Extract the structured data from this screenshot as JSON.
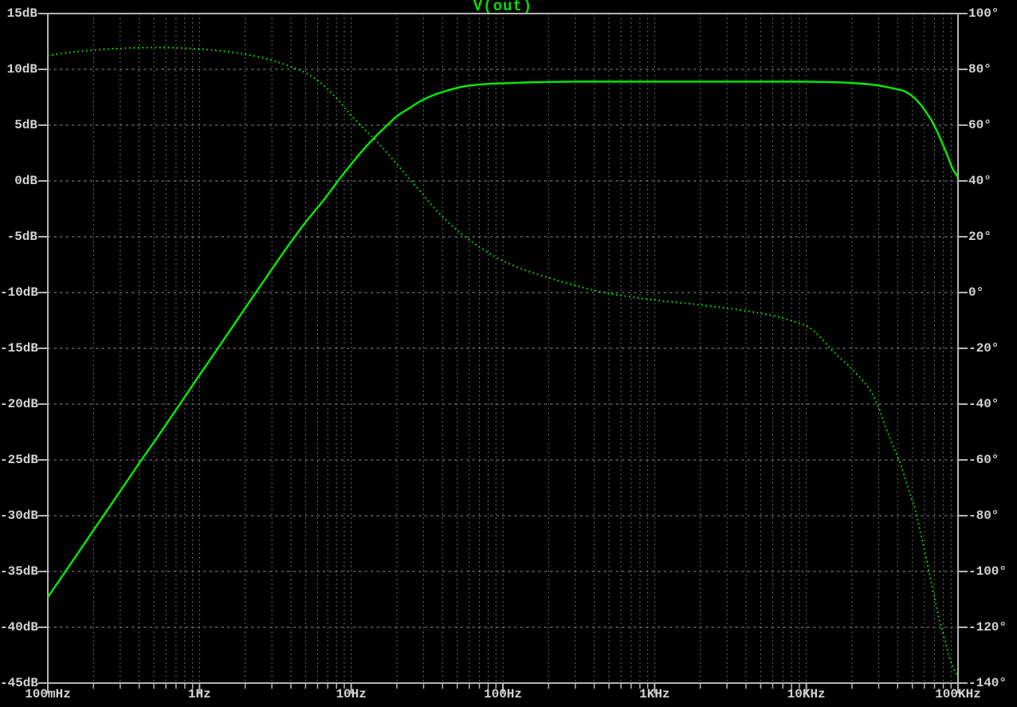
{
  "colors": {
    "background": "#000000",
    "trace": "#00ee00",
    "title": "#00dd00",
    "grid": "#8a8a8a",
    "frame": "#b4b4b4",
    "label": "#d4d4d4"
  },
  "chart_data": {
    "type": "line",
    "title": "V(out)",
    "grid": true,
    "legend_position": "top-center",
    "x_axis": {
      "scale": "log",
      "min": 0.1,
      "max": 100000,
      "unit": "Hz",
      "tick_labels": [
        "100mHz",
        "1Hz",
        "10Hz",
        "100Hz",
        "1KHz",
        "10KHz",
        "100KHz"
      ],
      "tick_values": [
        0.1,
        1,
        10,
        100,
        1000,
        10000,
        100000
      ]
    },
    "y_left": {
      "unit": "dB",
      "min": -45,
      "max": 15,
      "step": 5,
      "tick_labels": [
        "15dB",
        "10dB",
        "5dB",
        "0dB",
        "-5dB",
        "-10dB",
        "-15dB",
        "-20dB",
        "-25dB",
        "-30dB",
        "-35dB",
        "-40dB",
        "-45dB"
      ],
      "tick_values": [
        15,
        10,
        5,
        0,
        -5,
        -10,
        -15,
        -20,
        -25,
        -30,
        -35,
        -40,
        -45
      ]
    },
    "y_right": {
      "unit": "°",
      "min": -140,
      "max": 100,
      "step": 20,
      "tick_labels": [
        "100°",
        "80°",
        "60°",
        "40°",
        "20°",
        "0°",
        "-20°",
        "-40°",
        "-60°",
        "-80°",
        "-100°",
        "-120°",
        "-140°"
      ],
      "tick_values": [
        100,
        80,
        60,
        40,
        20,
        0,
        -20,
        -40,
        -60,
        -80,
        -100,
        -120,
        -140
      ]
    },
    "series": [
      {
        "name": "V(out) magnitude",
        "axis": "left",
        "style": "solid",
        "unit": "dB",
        "points": [
          [
            0.1,
            -37.3
          ],
          [
            0.14,
            -34.4
          ],
          [
            0.2,
            -31.3
          ],
          [
            0.28,
            -28.4
          ],
          [
            0.4,
            -25.3
          ],
          [
            0.55,
            -22.6
          ],
          [
            0.75,
            -19.9
          ],
          [
            1,
            -17.4
          ],
          [
            1.4,
            -14.5
          ],
          [
            2,
            -11.4
          ],
          [
            2.8,
            -8.5
          ],
          [
            3.8,
            -5.9
          ],
          [
            5,
            -3.7
          ],
          [
            6.5,
            -1.8
          ],
          [
            8.5,
            0.3
          ],
          [
            10,
            1.5
          ],
          [
            12,
            2.8
          ],
          [
            14.5,
            4.0
          ],
          [
            17,
            4.9
          ],
          [
            20,
            5.8
          ],
          [
            24,
            6.5
          ],
          [
            29,
            7.2
          ],
          [
            35,
            7.7
          ],
          [
            43,
            8.1
          ],
          [
            52,
            8.4
          ],
          [
            65,
            8.6
          ],
          [
            80,
            8.7
          ],
          [
            100,
            8.75
          ],
          [
            140,
            8.82
          ],
          [
            200,
            8.87
          ],
          [
            300,
            8.9
          ],
          [
            500,
            8.9
          ],
          [
            800,
            8.9
          ],
          [
            1300,
            8.9
          ],
          [
            2000,
            8.9
          ],
          [
            3200,
            8.9
          ],
          [
            5000,
            8.9
          ],
          [
            8000,
            8.9
          ],
          [
            12000,
            8.88
          ],
          [
            16000,
            8.84
          ],
          [
            20000,
            8.78
          ],
          [
            25000,
            8.68
          ],
          [
            30000,
            8.55
          ],
          [
            35000,
            8.38
          ],
          [
            40000,
            8.2
          ],
          [
            45000,
            8.0
          ],
          [
            51000,
            7.5
          ],
          [
            57000,
            6.8
          ],
          [
            62000,
            6.1
          ],
          [
            67000,
            5.4
          ],
          [
            73000,
            4.4
          ],
          [
            78000,
            3.5
          ],
          [
            85000,
            2.3
          ],
          [
            92000,
            1.1
          ],
          [
            96000,
            0.7
          ],
          [
            100000,
            0.3
          ]
        ]
      },
      {
        "name": "V(out) phase",
        "axis": "right",
        "style": "dotted",
        "unit": "deg",
        "points": [
          [
            0.1,
            85.0
          ],
          [
            0.14,
            86.1
          ],
          [
            0.2,
            86.9
          ],
          [
            0.3,
            87.5
          ],
          [
            0.45,
            87.8
          ],
          [
            0.6,
            87.8
          ],
          [
            0.8,
            87.6
          ],
          [
            1,
            87.3
          ],
          [
            1.4,
            86.6
          ],
          [
            2,
            85.4
          ],
          [
            2.8,
            83.7
          ],
          [
            3.8,
            81.4
          ],
          [
            5,
            78.7
          ],
          [
            6.5,
            74.5
          ],
          [
            8.5,
            68.0
          ],
          [
            10,
            63.5
          ],
          [
            12,
            59.0
          ],
          [
            14.5,
            54.5
          ],
          [
            17,
            50.5
          ],
          [
            20,
            46.0
          ],
          [
            24,
            41.0
          ],
          [
            29,
            35.8
          ],
          [
            35,
            30.5
          ],
          [
            43,
            25.5
          ],
          [
            52,
            21.5
          ],
          [
            65,
            17.5
          ],
          [
            80,
            14.3
          ],
          [
            100,
            11.3
          ],
          [
            140,
            8.0
          ],
          [
            200,
            5.3
          ],
          [
            280,
            3.0
          ],
          [
            400,
            0.8
          ],
          [
            550,
            -0.7
          ],
          [
            750,
            -1.8
          ],
          [
            1000,
            -2.7
          ],
          [
            1500,
            -3.7
          ],
          [
            2200,
            -4.7
          ],
          [
            3200,
            -5.8
          ],
          [
            4700,
            -7.2
          ],
          [
            6800,
            -9.0
          ],
          [
            10000,
            -12.0
          ],
          [
            12000,
            -15.3
          ],
          [
            14500,
            -20.3
          ],
          [
            17000,
            -23.8
          ],
          [
            20000,
            -27.4
          ],
          [
            23000,
            -31.0
          ],
          [
            26000,
            -34.5
          ],
          [
            29500,
            -40.3
          ],
          [
            33500,
            -48.5
          ],
          [
            37000,
            -54.5
          ],
          [
            41500,
            -61.0
          ],
          [
            45000,
            -67.0
          ],
          [
            48500,
            -72.5
          ],
          [
            52000,
            -77.5
          ],
          [
            56000,
            -85.0
          ],
          [
            61000,
            -94.0
          ],
          [
            65000,
            -101.0
          ],
          [
            70000,
            -109.4
          ],
          [
            75500,
            -117.5
          ],
          [
            82000,
            -124.6
          ],
          [
            88000,
            -131.0
          ],
          [
            94000,
            -135.0
          ],
          [
            100000,
            -137.5
          ]
        ]
      }
    ]
  }
}
